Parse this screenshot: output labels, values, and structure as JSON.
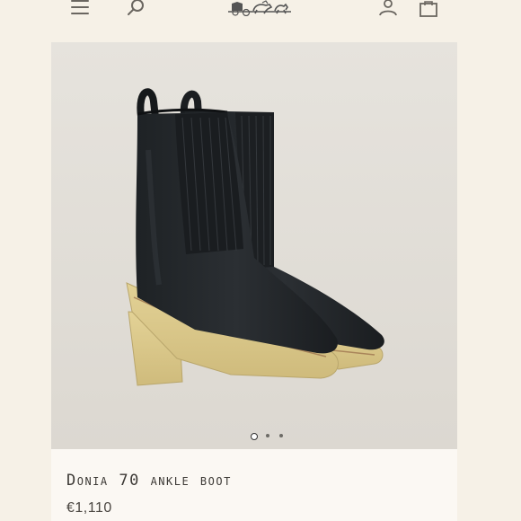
{
  "header": {
    "icons": [
      "menu-icon",
      "search-icon",
      "carriage-logo",
      "account-icon",
      "shopping-bag-icon"
    ]
  },
  "product": {
    "name": "Donia 70 ankle boot",
    "price": "€1,110",
    "image": {
      "subject": "ankle-boot",
      "upper_color": "#23272a",
      "sole_color": "#d9c689",
      "background_color": "#e2dfd8"
    },
    "carousel": {
      "total": 3,
      "current": 1
    }
  }
}
